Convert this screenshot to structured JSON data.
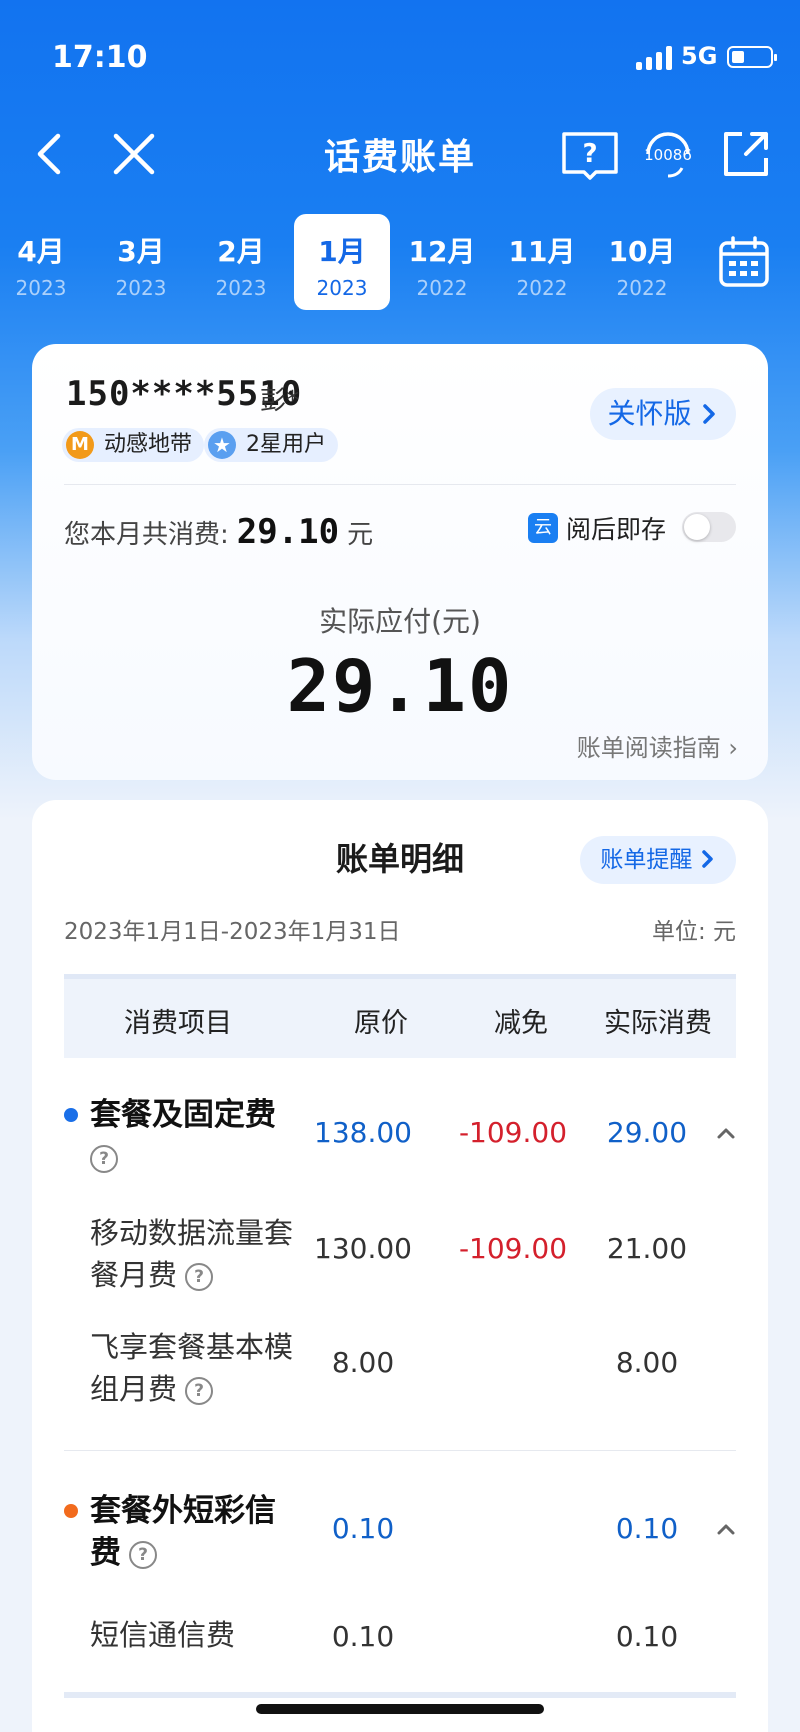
{
  "status_bar": {
    "time": "17:10",
    "network": "5G"
  },
  "nav": {
    "title": "话费账单",
    "service_number": "10086"
  },
  "months": [
    {
      "month": "4月",
      "year": "2023",
      "active": false
    },
    {
      "month": "3月",
      "year": "2023",
      "active": false
    },
    {
      "month": "2月",
      "year": "2023",
      "active": false
    },
    {
      "month": "1月",
      "year": "2023",
      "active": true
    },
    {
      "month": "12月",
      "year": "2022",
      "active": false
    },
    {
      "month": "11月",
      "year": "2022",
      "active": false
    },
    {
      "month": "10月",
      "year": "2022",
      "active": false
    }
  ],
  "summary": {
    "phone": "150****5510",
    "name": "彭*",
    "care_label": "关怀版",
    "tags": [
      "动感地带",
      "2星用户"
    ],
    "tag_badges": [
      "M",
      "★"
    ],
    "month_spend_label": "您本月共消费:",
    "month_spend_amount": "29.10",
    "month_spend_unit": "元",
    "save_icon_text": "云",
    "save_label": "阅后即存",
    "pay_label": "实际应付(元)",
    "pay_amount": "29.10",
    "guide_label": "账单阅读指南",
    "guide_arrow": "›"
  },
  "detail": {
    "title": "账单明细",
    "remind_label": "账单提醒",
    "period": "2023年1月1日-2023年1月31日",
    "unit": "单位: 元",
    "headers": [
      "消费项目",
      "原价",
      "减免",
      "实际消费"
    ],
    "groups": [
      {
        "name": "套餐及固定费",
        "dot_color": "#1a6fe8",
        "original": "138.00",
        "discount": "-109.00",
        "actual": "29.00",
        "items": [
          {
            "name": "移动数据流量套餐月费",
            "original": "130.00",
            "discount": "-109.00",
            "actual": "21.00"
          },
          {
            "name": "飞享套餐基本模组月费",
            "original": "8.00",
            "discount": "",
            "actual": "8.00"
          }
        ]
      },
      {
        "name": "套餐外短彩信费",
        "dot_color": "#f26b1d",
        "original": "0.10",
        "discount": "",
        "actual": "0.10",
        "items": [
          {
            "name": "短信通信费",
            "original": "0.10",
            "discount": "",
            "actual": "0.10"
          }
        ]
      }
    ]
  },
  "colors": {
    "brand_blue": "#1468e6",
    "discount_red": "#d4202c",
    "value_blue": "#1060c8"
  }
}
